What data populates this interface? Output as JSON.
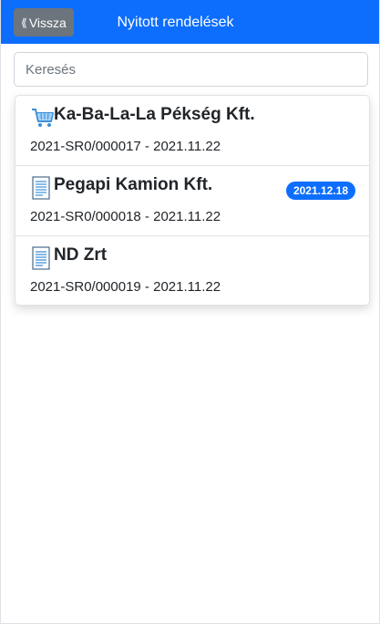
{
  "header": {
    "back_label": "Vissza",
    "title": "Nyitott rendelések"
  },
  "search": {
    "placeholder": "Keresés",
    "value": ""
  },
  "orders": [
    {
      "icon": "shopping-cart-icon",
      "name": "Ka-Ba-La-La Pékség Kft.",
      "subtitle": "2021-SR0/000017 - 2021.11.22",
      "badge": ""
    },
    {
      "icon": "document-icon",
      "name": "Pegapi Kamion Kft.",
      "subtitle": "2021-SR0/000018 - 2021.11.22",
      "badge": "2021.12.18"
    },
    {
      "icon": "document-icon",
      "name": "ND Zrt",
      "subtitle": "2021-SR0/000019 - 2021.11.22",
      "badge": ""
    }
  ],
  "colors": {
    "header_bg": "#0d6efd",
    "back_button_bg": "#6c757d",
    "badge_bg": "#0d6efd"
  }
}
